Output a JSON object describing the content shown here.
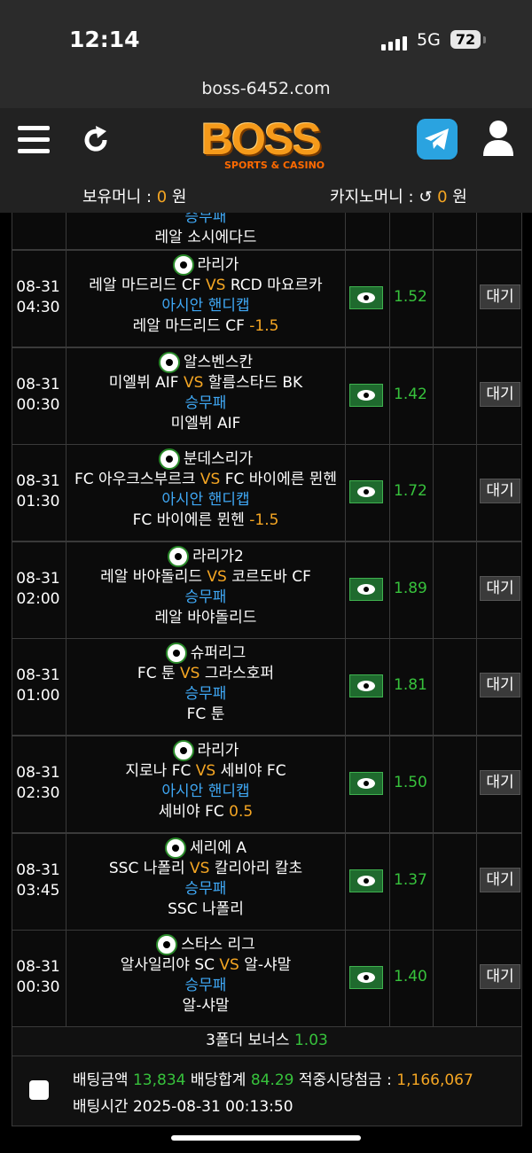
{
  "status": {
    "time": "12:14",
    "network": "5G",
    "battery": "72"
  },
  "url": "boss-6452.com",
  "header": {
    "logo": "BOSS",
    "logo_sub": "SPORTS & CASINO"
  },
  "balances": {
    "holding_label": "보유머니 : ",
    "holding_value": "0",
    "holding_unit": " 원",
    "casino_label": "카지노머니 : ",
    "casino_value": "0",
    "casino_unit": " 원"
  },
  "partial_row": {
    "market": "승무패",
    "pick": "레알 소시에다드"
  },
  "bets": [
    {
      "date": "08-31",
      "time": "04:30",
      "league": "라리가",
      "home": "레알 마드리드 CF",
      "away": "RCD 마요르카",
      "market": "아시안 핸디캡",
      "pick": "레알 마드리드 CF",
      "line": "-1.5",
      "odds": "1.52",
      "status": "대기"
    },
    {
      "date": "08-31",
      "time": "00:30",
      "league": "알스벤스칸",
      "home": "미엘뷔 AIF",
      "away": "할름스타드 BK",
      "market": "승무패",
      "pick": "미엘뷔 AIF",
      "line": "",
      "odds": "1.42",
      "status": "대기"
    },
    {
      "date": "08-31",
      "time": "01:30",
      "league": "분데스리가",
      "home": "FC 아우크스부르크",
      "away": "FC 바이에른 뮌헨",
      "market": "아시안 핸디캡",
      "pick": "FC 바이에른 뮌헨",
      "line": "-1.5",
      "odds": "1.72",
      "status": "대기"
    },
    {
      "date": "08-31",
      "time": "02:00",
      "league": "라리가2",
      "home": "레알 바야돌리드",
      "away": "코르도바 CF",
      "market": "승무패",
      "pick": "레알 바야돌리드",
      "line": "",
      "odds": "1.89",
      "status": "대기"
    },
    {
      "date": "08-31",
      "time": "01:00",
      "league": "슈퍼리그",
      "home": "FC 툰",
      "away": "그라스호퍼",
      "market": "승무패",
      "pick": "FC 툰",
      "line": "",
      "odds": "1.81",
      "status": "대기"
    },
    {
      "date": "08-31",
      "time": "02:30",
      "league": "라리가",
      "home": "지로나 FC",
      "away": "세비야 FC",
      "market": "아시안 핸디캡",
      "pick": "세비야 FC",
      "line": "0.5",
      "odds": "1.50",
      "status": "대기"
    },
    {
      "date": "08-31",
      "time": "03:45",
      "league": "세리에 A",
      "home": "SSC 나폴리",
      "away": "칼리아리 칼초",
      "market": "승무패",
      "pick": "SSC 나폴리",
      "line": "",
      "odds": "1.37",
      "status": "대기"
    },
    {
      "date": "08-31",
      "time": "00:30",
      "league": "스타스 리그",
      "home": "알사일리야 SC",
      "away": "알-샤말",
      "market": "승무패",
      "pick": "알-샤말",
      "line": "",
      "odds": "1.40",
      "status": "대기"
    }
  ],
  "vs": "VS",
  "bonus": {
    "label": "3폴더 보너스 ",
    "value": "1.03"
  },
  "summary": {
    "amount_label": "배팅금액 ",
    "amount": "13,834",
    "total_odds_label": " 배당합계 ",
    "total_odds": "84.29",
    "payout_label": " 적중시당첨금 : ",
    "payout": "1,166,067",
    "time_label": "배팅시간 ",
    "time": "2025-08-31 00:13:50"
  }
}
